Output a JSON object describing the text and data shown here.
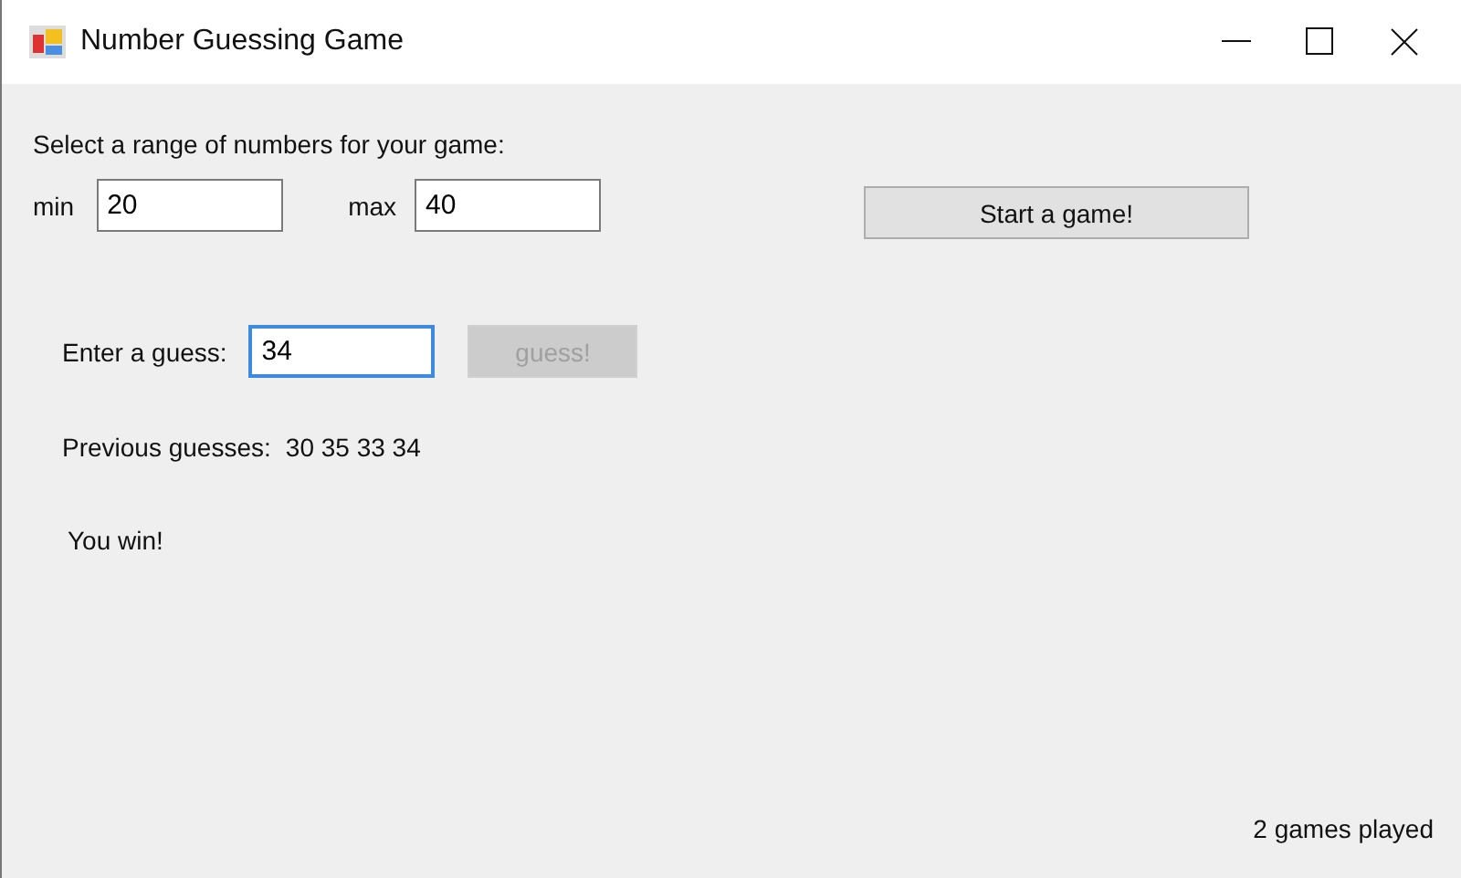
{
  "window": {
    "title": "Number Guessing Game"
  },
  "range_label": "Select a range of numbers for your game:",
  "min": {
    "label": "min",
    "value": "20"
  },
  "max": {
    "label": "max",
    "value": "40"
  },
  "start_button": {
    "label": "Start a game!",
    "disabled": false
  },
  "guess": {
    "label": "Enter a guess:",
    "value": "34",
    "focused": true
  },
  "guess_button": {
    "label": "guess!",
    "disabled": true
  },
  "previous": {
    "label": "Previous guesses:",
    "value": "30 35 33 34"
  },
  "result": "You win!",
  "games_played": "2 games played"
}
